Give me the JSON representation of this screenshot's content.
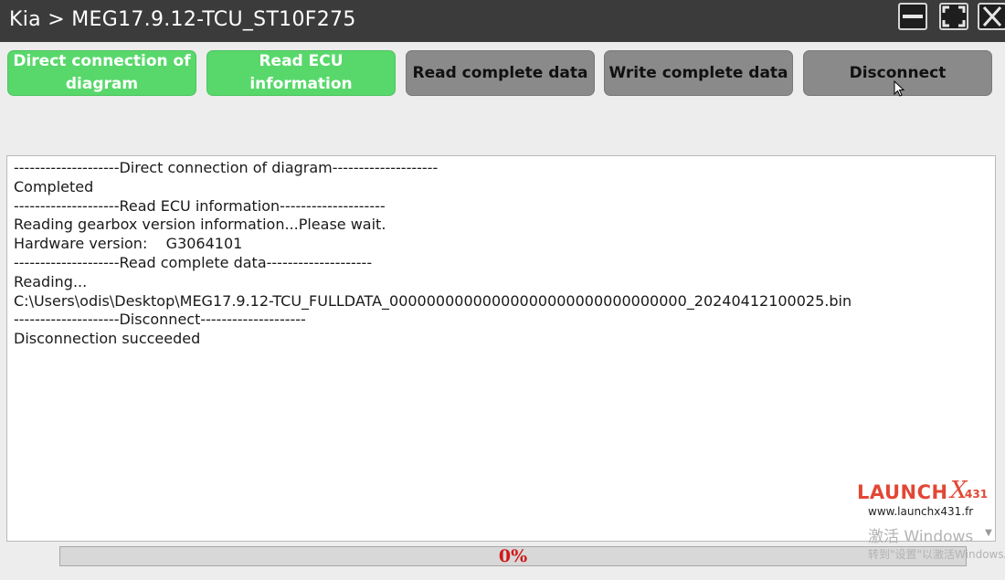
{
  "window": {
    "title": "Kia > MEG17.9.12-TCU_ST10F275",
    "controls": [
      "minimize-icon",
      "maximize-icon",
      "close-icon"
    ]
  },
  "toolbar": {
    "buttons": [
      {
        "label": "Direct connection of diagram",
        "state": "active",
        "color": "#58d86b"
      },
      {
        "label": "Read ECU information",
        "state": "active",
        "color": "#58d86b"
      },
      {
        "label": "Read complete data",
        "state": "normal",
        "color": "#8a8a8a"
      },
      {
        "label": "Write complete data",
        "state": "normal",
        "color": "#8a8a8a"
      },
      {
        "label": "Disconnect",
        "state": "hover",
        "color": "#8a8a8a"
      }
    ]
  },
  "log": {
    "lines": [
      "--------------------Direct connection of diagram--------------------",
      "Completed",
      "--------------------Read ECU information--------------------",
      "Reading gearbox version information...Please wait.",
      "Hardware version:    G3064101",
      "--------------------Read complete data--------------------",
      "Reading...",
      "C:\\Users\\odis\\Desktop\\MEG17.9.12-TCU_FULLDATA_00000000000000000000000000000000_20240412100025.bin",
      "--------------------Disconnect--------------------",
      "Disconnection succeeded"
    ]
  },
  "progress": {
    "text": "0%",
    "value": 0,
    "text_color": "#d01818"
  },
  "watermark": {
    "brand": "LAUNCH",
    "brand_mark": "X",
    "brand_suffix": "431",
    "url": "www.launchx431.fr",
    "brand_color": "#e24735"
  },
  "windows_activation": {
    "line1": "激活 Windows",
    "line2": "转到\"设置\"以激活Windows。"
  }
}
